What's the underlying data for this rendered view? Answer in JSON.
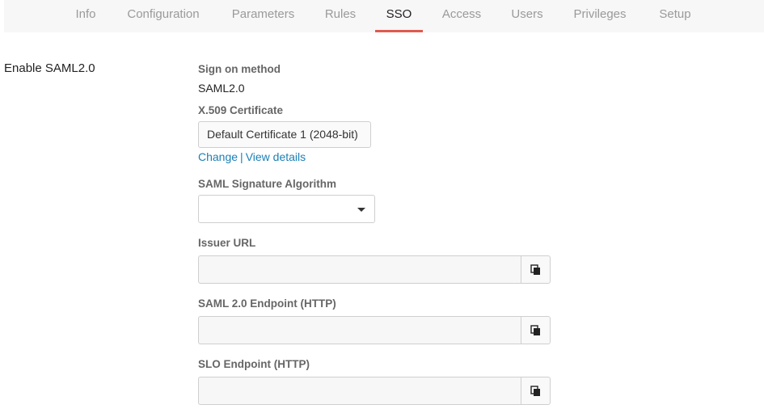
{
  "tabs": [
    {
      "label": "Info",
      "active": false
    },
    {
      "label": "Configuration",
      "active": false
    },
    {
      "label": "Parameters",
      "active": false
    },
    {
      "label": "Rules",
      "active": false
    },
    {
      "label": "SSO",
      "active": true
    },
    {
      "label": "Access",
      "active": false
    },
    {
      "label": "Users",
      "active": false
    },
    {
      "label": "Privileges",
      "active": false
    },
    {
      "label": "Setup",
      "active": false
    }
  ],
  "accent_color": "#e05a4f",
  "link_color": "#1a80b6",
  "section": {
    "title": "Enable SAML2.0"
  },
  "sign_on": {
    "label": "Sign on method",
    "value": "SAML2.0"
  },
  "certificate": {
    "label": "X.509 Certificate",
    "value": "Default Certificate 1 (2048-bit)",
    "change_link": "Change",
    "separator": "|",
    "details_link": "View details"
  },
  "signature_algorithm": {
    "label": "SAML Signature Algorithm",
    "value": ""
  },
  "issuer_url": {
    "label": "Issuer URL",
    "value": "",
    "copy_icon": "copy-icon"
  },
  "saml_endpoint": {
    "label": "SAML 2.0 Endpoint (HTTP)",
    "value": "",
    "copy_icon": "copy-icon"
  },
  "slo_endpoint": {
    "label": "SLO Endpoint (HTTP)",
    "value": "",
    "copy_icon": "copy-icon"
  }
}
